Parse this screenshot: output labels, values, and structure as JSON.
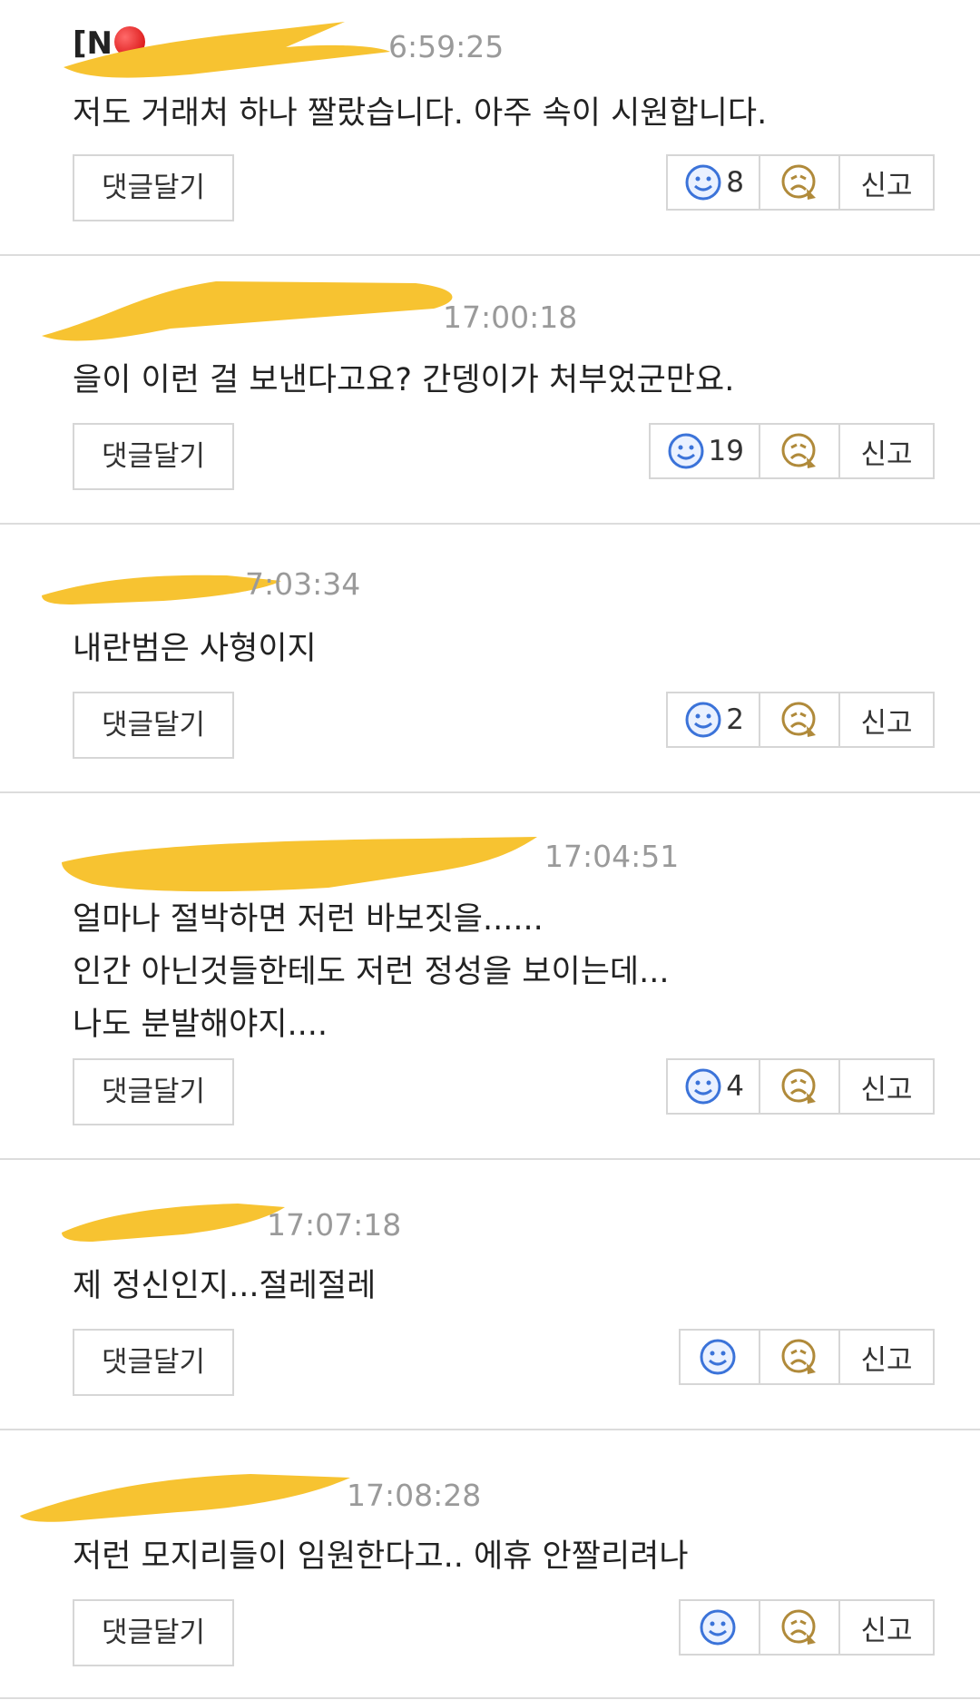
{
  "labels": {
    "reply": "댓글달기",
    "report": "신고"
  },
  "colors": {
    "scribble": "#F7C331",
    "like_icon": "#3b73d9",
    "dislike_icon": "#b08a3a"
  },
  "comments": [
    {
      "author_visible": "[N",
      "time": "6:59:25",
      "text": "저도 거래처 하나 짤랐습니다. 아주 속이 시원합니다.",
      "likes": "8"
    },
    {
      "author_visible": "",
      "time": "17:00:18",
      "text": "을이 이런 걸 보낸다고요? 간뎅이가 처부었군만요.",
      "likes": "19"
    },
    {
      "author_visible": "",
      "time": "7:03:34",
      "text": "내란범은 사형이지",
      "likes": "2"
    },
    {
      "author_visible": "",
      "time": "17:04:51",
      "text": "얼마나 절박하면 저런 바보짓을......\n인간 아닌것들한테도 저런 정성을 보이는데...\n나도 분발해야지....",
      "likes": "4"
    },
    {
      "author_visible": "",
      "time": "17:07:18",
      "text": "제 정신인지...절레절레",
      "likes": ""
    },
    {
      "author_visible": "",
      "time": "17:08:28",
      "text": "저런 모지리들이 임원한다고.. 에휴 안짤리려나",
      "likes": ""
    }
  ]
}
